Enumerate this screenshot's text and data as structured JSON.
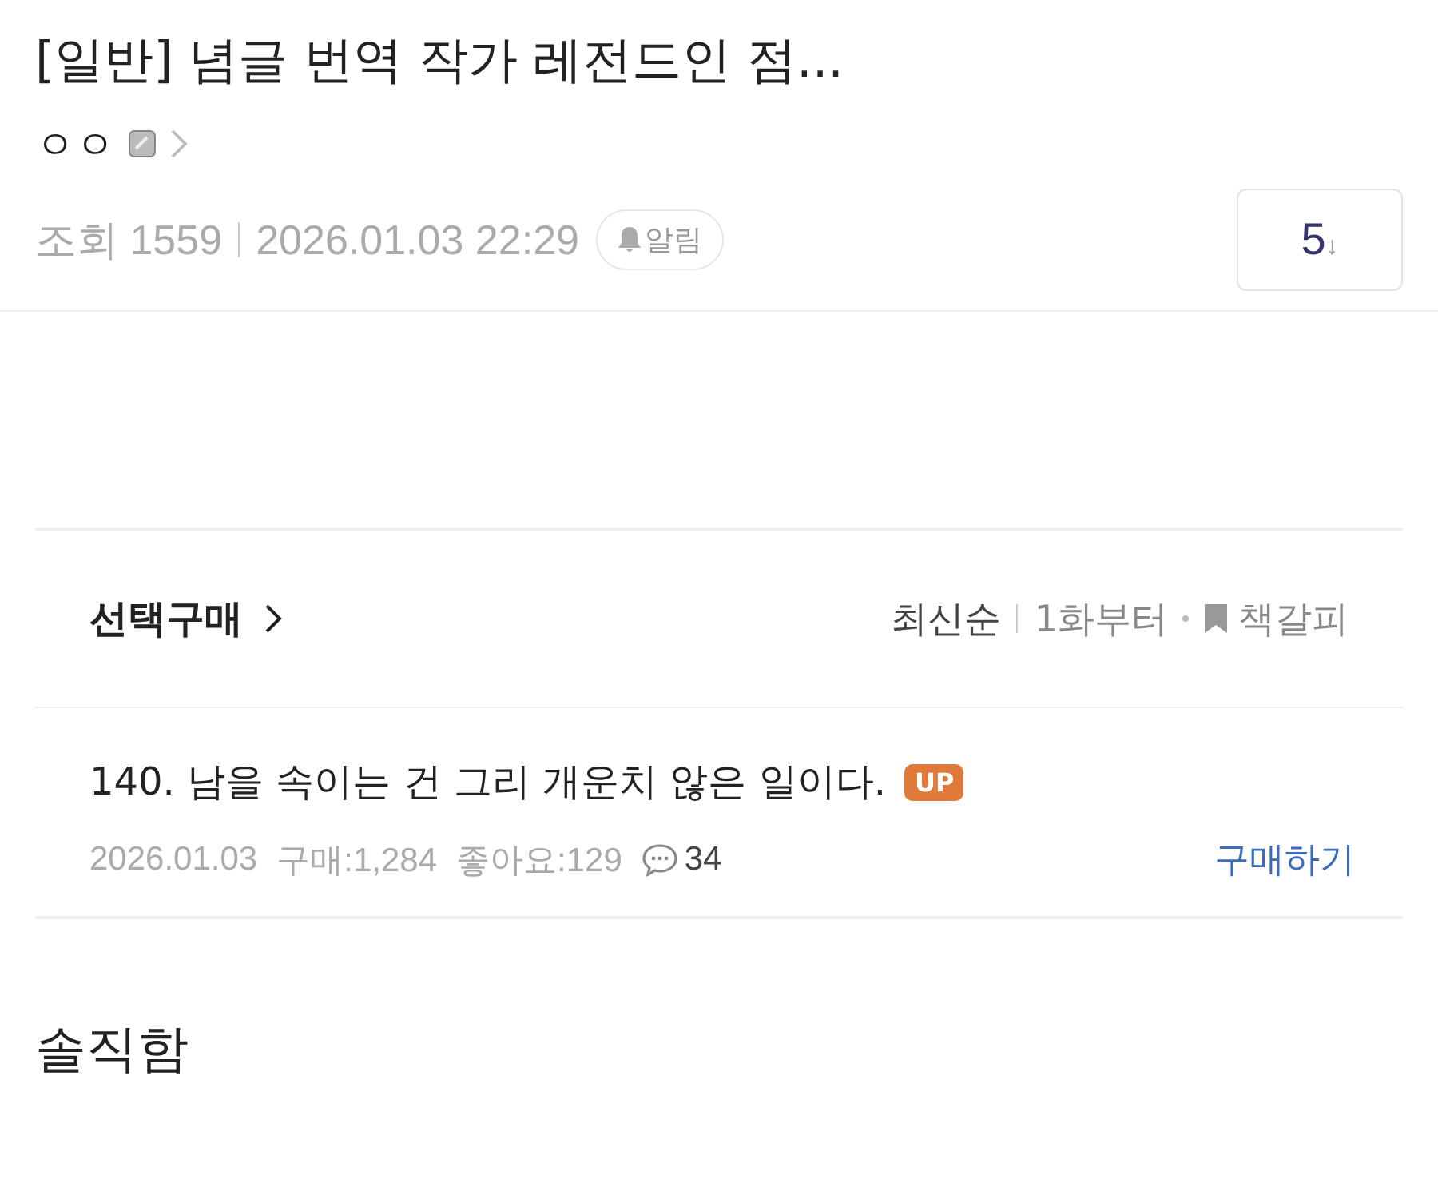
{
  "post": {
    "title": "[일반] 념글 번역 작가 레전드인 점...",
    "author": "ㅇㅇ",
    "views_label": "조회",
    "views": "1559",
    "datetime": "2026.01.03 22:29",
    "alert_label": "알림",
    "comment_count": "5",
    "comment_arrow": "↓"
  },
  "purchase": {
    "title": "선택구매",
    "sort_options": [
      {
        "label": "최신순",
        "selected": true
      },
      {
        "label": "1화부터",
        "selected": false
      }
    ],
    "bookmark": "책갈피",
    "episode": {
      "title": "140. 남을 속이는 건 그리 개운치 않은 일이다.",
      "badge": "UP",
      "date": "2026.01.03",
      "purchases": "구매:1,284",
      "likes": "좋아요:129",
      "comments": "34",
      "buy": "구매하기"
    }
  },
  "body": "솔직함"
}
